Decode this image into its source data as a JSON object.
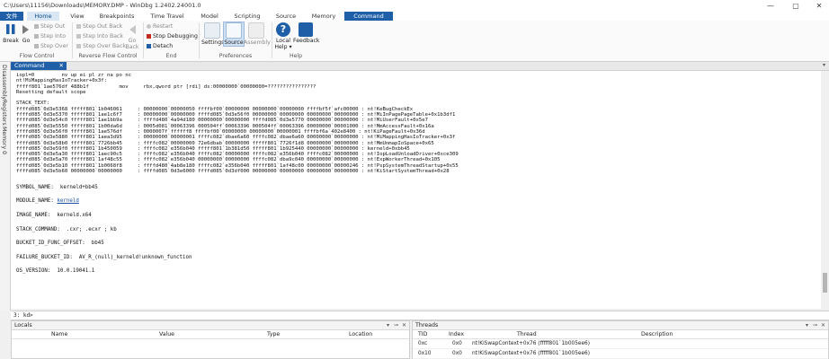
{
  "window": {
    "title": "C:\\Users\\11156\\Downloads\\MEMORY.DMP - WinDbg 1.2402.24001.0",
    "controls": [
      "—",
      "▢",
      "✕"
    ]
  },
  "ribbon_tabs": [
    "文件",
    "Home",
    "View",
    "Breakpoints",
    "Time Travel",
    "Model",
    "Scripting",
    "Source",
    "Memory",
    "Command"
  ],
  "ribbon": {
    "flow_control": {
      "label": "Flow Control",
      "break": "Break",
      "go": "Go",
      "step_out": "Step Out",
      "step_into": "Step Into",
      "step_over": "Step Over"
    },
    "reverse_flow_control": {
      "label": "Reverse Flow Control",
      "step_out_back": "Step Out Back",
      "step_into_back": "Step Into Back",
      "step_over_back": "Step Over Back",
      "go_back": "Go Back"
    },
    "end": {
      "label": "End",
      "restart": "Restart",
      "stop_debugging": "Stop Debugging",
      "detach": "Detach"
    },
    "preferences": {
      "label": "Preferences",
      "settings": "Settings",
      "source": "Source",
      "assembly": "Assembly"
    },
    "help": {
      "label": "Help",
      "local_help": "Local Help",
      "local_help_arrow": "▾",
      "feedback": "Feedback"
    }
  },
  "side_tabs": [
    "Disassembly",
    "Registers",
    "Memory 0"
  ],
  "command_tab": {
    "label": "Command",
    "close": "✕"
  },
  "output": {
    "lines": [
      "iopl=0         nv up ei pl zr na po nc",
      "nt!MiMappingHasIoTracker+0x3f:",
      "fffff801`1ae576df 488b1f          mov     rbx,qword ptr [rdi] ds:00000000`00000000=????????????????",
      "Resetting default scope",
      "",
      "STACK_TEXT:",
      "ffffd085`0d3e5368 fffff801`1b046061     : 00000000`00000050 ffffbf00`00000000 00000000`00000000 ffffbf5f`afc00000 : nt!KeBugCheckEx",
      "ffffd085`0d3e5370 fffff801`1ae1c6f7     : 00000000`00000000 ffffd085`0d3e56f0 00000000`00000000 00000000`00000000 : nt!MiInPagePageTable+0x1b3df1",
      "ffffd085`0d3e54c0 fffff801`1ae1bb9a     : ffffd480`4a94d180 00000000`00000000 ffffd085`0d3e5770 00000000`00000000 : nt!MiUserFault+0x5e7",
      "ffffd085`0d3e5550 fffff801`1b00da6d     : 0005d081`00063396 000504ff`00063396 000504ff`00063396 00000000`00001000 : nt!MmAccessFault+0x16a",
      "ffffd085`0d3e56f0 fffff801`1ae576df     : 0000007f`ffffff8 ffffbf00`00000000 00000000`00000001 ffffbf6a`402e8400 : nt!KiPageFault+0x36d",
      "ffffd085`0d3e5880 fffff801`1aea3d95     : 00000000`00000001 ffffc082`dbae6a60 ffffc082`dbae6a60 00000000`00000000 : nt!MiMappingHasIoTracker+0x3f",
      "ffffd085`0d3e58b0 fffff801`7726bb45     : ffffc082`00000000 72e6dbab`00000000 fffff801`7726f1d8 00000000`00000000 : nt!MmUnmapIoSpace+0x65",
      "ffffd085`0d3e59f0 fffff801`1b450059     : ffffc082`e356b040 fffff801`1b381d50 fffff801`1b925440 00000000`00000000 : kerneld+0xbb45",
      "ffffd085`0d3e5a30 fffff801`1aec90c5     : ffffc082`e356b040 ffffc082`00000000 ffffc082`e356b040 ffffc082`00000000 : nt!IopLoadUnloadDriver+0xce309",
      "ffffd085`0d3e5a70 fffff801`1af48c55     : ffffc082`e356b040 00000000`00000000 ffffc082`dba9c040 00000000`00000000 : nt!ExpWorkerThread+0x105",
      "ffffd085`0d3e5b10 fffff801`1b0068f8     : ffffd480`4ab8e180 ffffc082`e356b040 fffff801`1af48c00 00000000`00000246 : nt!PspSystemThreadStartup+0x55",
      "ffffd085`0d3e5b60 00000000`00000000     : ffffd085`0d3e6000 ffffd085`0d3df000 00000000`00000000 00000000`00000000 : nt!KiStartSystemThread+0x28"
    ],
    "symbol_name": {
      "key": "SYMBOL_NAME:",
      "value": "kerneld+bb45"
    },
    "module_name": {
      "key": "MODULE_NAME:",
      "value": "kerneld"
    },
    "image_name": {
      "key": "IMAGE_NAME:",
      "value": "kerneld.x64"
    },
    "stack_command": {
      "key": "STACK_COMMAND:",
      "value": ".cxr; .ecxr ; kb"
    },
    "bucket_id_func_offset": {
      "key": "BUCKET_ID_FUNC_OFFSET:",
      "value": "bb45"
    },
    "failure_bucket_id": {
      "key": "FAILURE_BUCKET_ID:",
      "value": "AV_R_(null)_kerneld!unknown_function"
    },
    "os_version": {
      "key": "OS_VERSION:",
      "value": "10.0.19041.1"
    }
  },
  "prompt": {
    "label": "3: kd>",
    "value": ""
  },
  "locals": {
    "title": "Locals",
    "columns": [
      "Name",
      "Value",
      "Type",
      "Location"
    ]
  },
  "threads": {
    "title": "Threads",
    "columns": [
      "TID",
      "Index",
      "Thread",
      "Description"
    ],
    "rows": [
      {
        "tid": "0xc",
        "index": "0x0",
        "thread": "nt!KiSwapContext+0x76 (fffff801`1b005ee6)"
      },
      {
        "tid": "0x10",
        "index": "0x0",
        "thread": "nt!KiSwapContext+0x76 (fffff801`1b005ee6)"
      }
    ]
  },
  "pane_controls": {
    "dropdown": "▾",
    "pin": "⊸",
    "close": "✕"
  },
  "colors": {
    "accent": "#1f5fa8",
    "link": "#1a4fa0",
    "active_tab_bg": "#d9e7f5"
  }
}
